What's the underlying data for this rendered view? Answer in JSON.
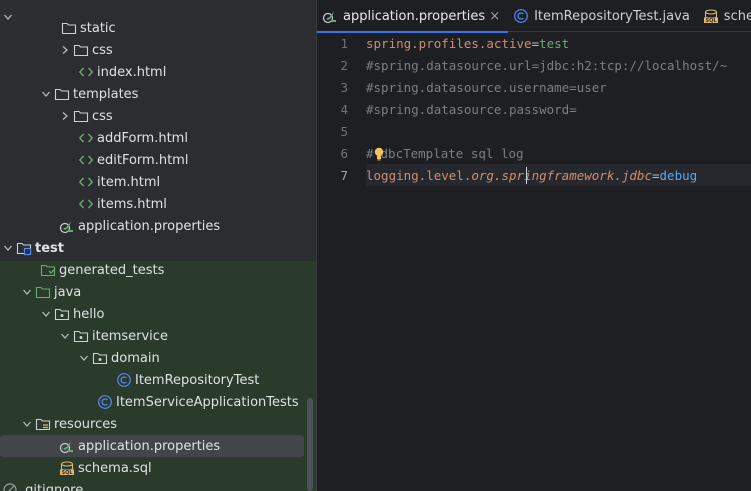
{
  "tree": {
    "items": [
      {
        "label": "static",
        "icon": "folder-icon"
      },
      {
        "label": "css",
        "icon": "folder-icon"
      },
      {
        "label": "index.html",
        "icon": "html-icon"
      },
      {
        "label": "templates",
        "icon": "folder-icon"
      },
      {
        "label": "css",
        "icon": "folder-icon"
      },
      {
        "label": "addForm.html",
        "icon": "html-icon"
      },
      {
        "label": "editForm.html",
        "icon": "html-icon"
      },
      {
        "label": "item.html",
        "icon": "html-icon"
      },
      {
        "label": "items.html",
        "icon": "html-icon"
      },
      {
        "label": "application.properties",
        "icon": "spring-properties-icon"
      },
      {
        "label": "test",
        "icon": "module-folder-icon"
      },
      {
        "label": "generated_tests",
        "icon": "generated-folder-icon"
      },
      {
        "label": "java",
        "icon": "test-source-folder-icon"
      },
      {
        "label": "hello",
        "icon": "package-icon"
      },
      {
        "label": "itemservice",
        "icon": "package-icon"
      },
      {
        "label": "domain",
        "icon": "package-icon"
      },
      {
        "label": "ItemRepositoryTest",
        "icon": "class-icon"
      },
      {
        "label": "ItemServiceApplicationTests",
        "icon": "class-icon"
      },
      {
        "label": "resources",
        "icon": "resources-folder-icon"
      },
      {
        "label": "application.properties",
        "icon": "spring-properties-icon"
      },
      {
        "label": "schema.sql",
        "icon": "sql-icon"
      },
      {
        "label": ".gitignore",
        "icon": "gitignore-icon"
      }
    ]
  },
  "tabs": [
    {
      "label": "application.properties",
      "icon": "spring-properties-icon",
      "active": true,
      "close": "×"
    },
    {
      "label": "ItemRepositoryTest.java",
      "icon": "class-icon",
      "active": false
    },
    {
      "label": "schema.sql",
      "icon": "sql-icon",
      "active": false
    }
  ],
  "editor": {
    "line_numbers": [
      "1",
      "2",
      "3",
      "4",
      "5",
      "6",
      "7"
    ],
    "current_line": 7,
    "lines": {
      "l1_key": "spring.profiles.active",
      "l1_eq": "=",
      "l1_val": "test",
      "l2": "#spring.datasource.url=jdbc:h2:tcp://localhost/~",
      "l3": "#spring.datasource.username=user",
      "l4": "#spring.datasource.password=",
      "l6_hash": "#",
      "l6_rest": "dbcTemplate sql log",
      "l7_a": "logging.level.",
      "l7_b": "org.springframework.jdbc",
      "l7_eq": "=",
      "l7_val": "debug"
    }
  },
  "colors": {
    "accent": "#3574f0",
    "key": "#cf8e6d",
    "value": "#6aab73",
    "comment": "#7a7e85",
    "debug_value": "#56a8f5"
  }
}
